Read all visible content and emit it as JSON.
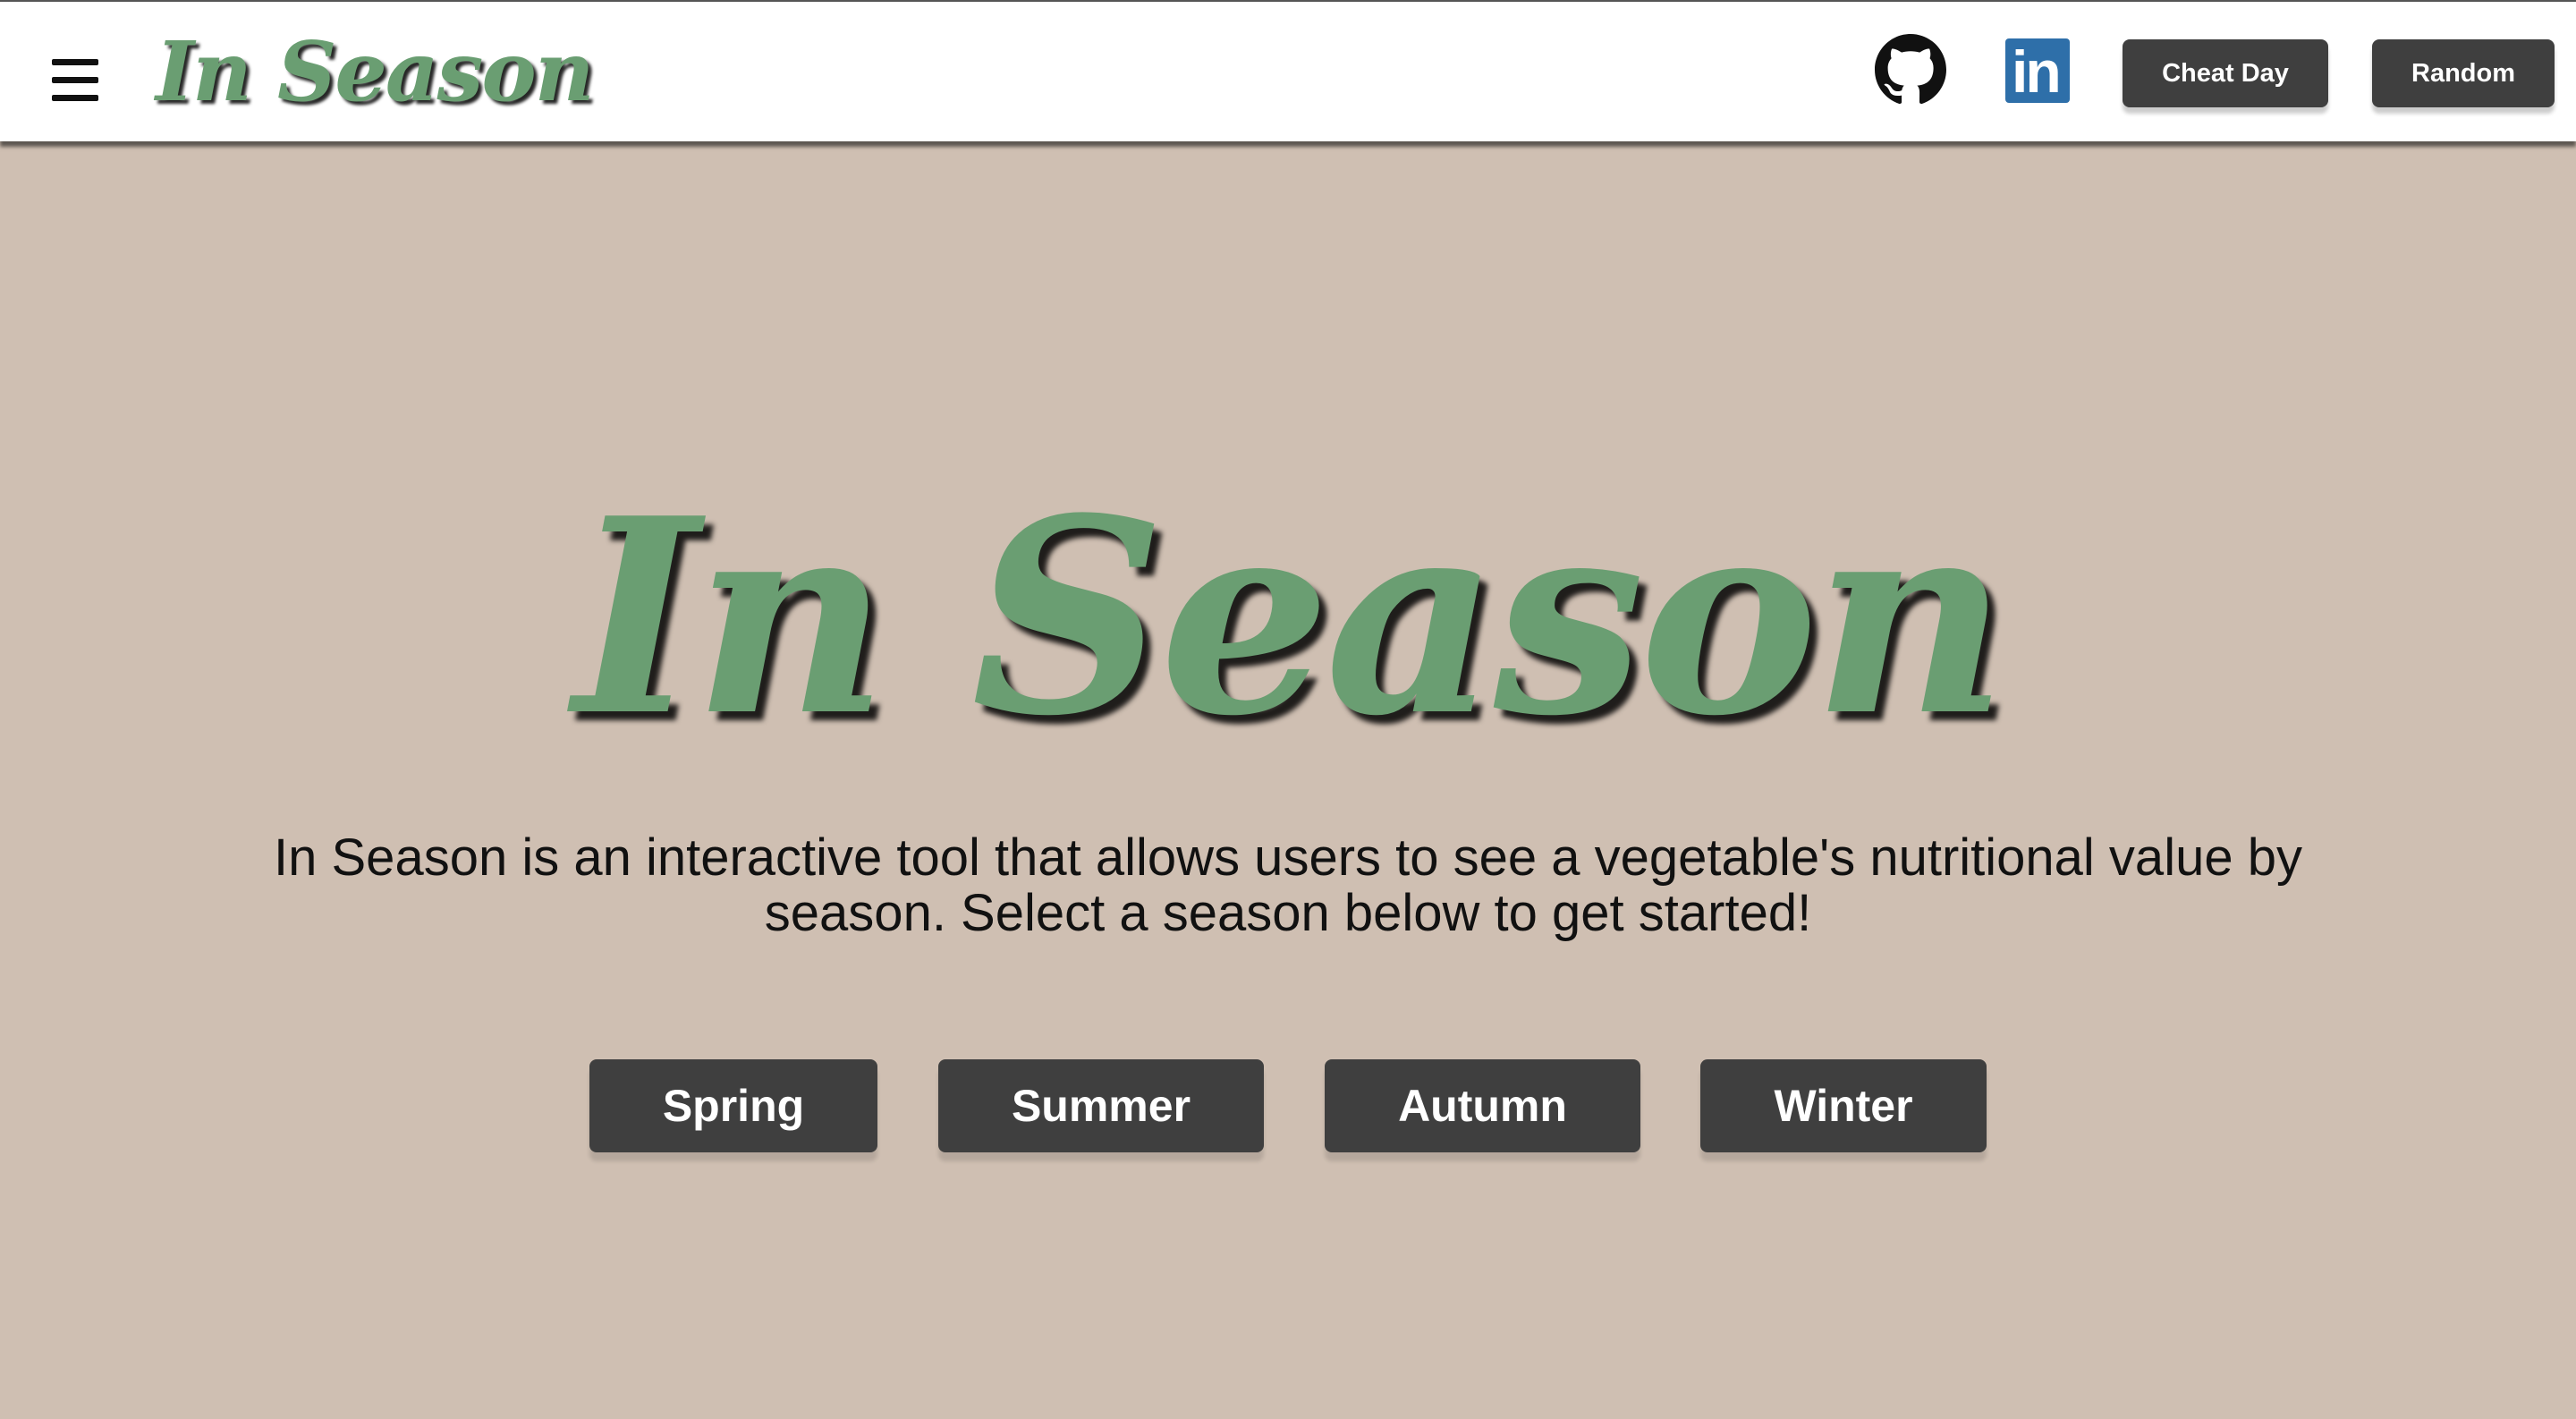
{
  "header": {
    "menu_icon": "hamburger-menu-icon",
    "logo_text": "In Season",
    "github_icon": "github-icon",
    "linkedin_icon": "linkedin-icon",
    "linkedin_glyph": "in",
    "cheat_day_label": "Cheat Day",
    "random_label": "Random"
  },
  "hero": {
    "title": "In Season",
    "description": "In Season is an interactive tool that allows users to see a vegetable's nutritional value by season. Select a season below to get started!"
  },
  "seasons": [
    "Spring",
    "Summer",
    "Autumn",
    "Winter"
  ],
  "colors": {
    "background": "#cfbfb2",
    "brand_green": "#6a9e72",
    "button_dark": "#3f3f3f",
    "linkedin_blue": "#2e6fa9",
    "header_bg": "#ffffff"
  }
}
